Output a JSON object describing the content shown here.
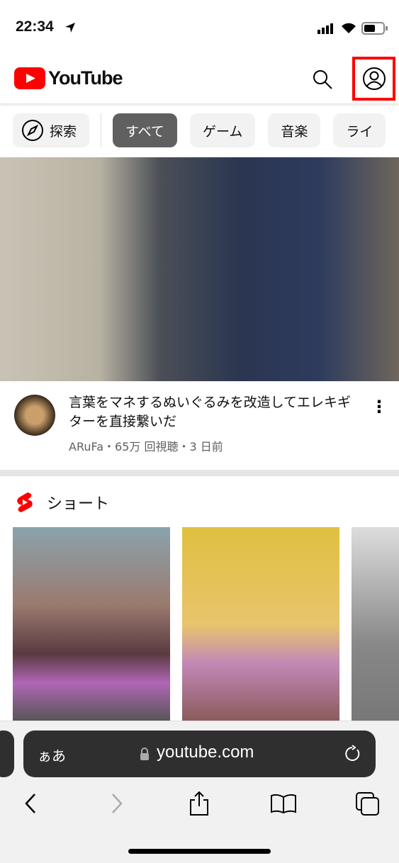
{
  "status": {
    "time": "22:34"
  },
  "header": {
    "logo": "YouTube",
    "search_icon": "search-icon",
    "account_icon": "account-icon",
    "highlight_color": "#ff0000"
  },
  "chips": [
    {
      "label": "探索"
    },
    {
      "label": "すべて"
    },
    {
      "label": "ゲーム"
    },
    {
      "label": "音楽"
    },
    {
      "label": "ライ"
    }
  ],
  "video": {
    "title": "言葉をマネするぬいぐるみを改造してエレキギターを直接繋いだ",
    "channel": "ARuFa",
    "views": "65万 回視聴",
    "age": "3 日前",
    "sep": "・"
  },
  "shorts": {
    "title": "ショート"
  },
  "browser": {
    "text_size": "ぁあ",
    "url": "youtube.com"
  }
}
